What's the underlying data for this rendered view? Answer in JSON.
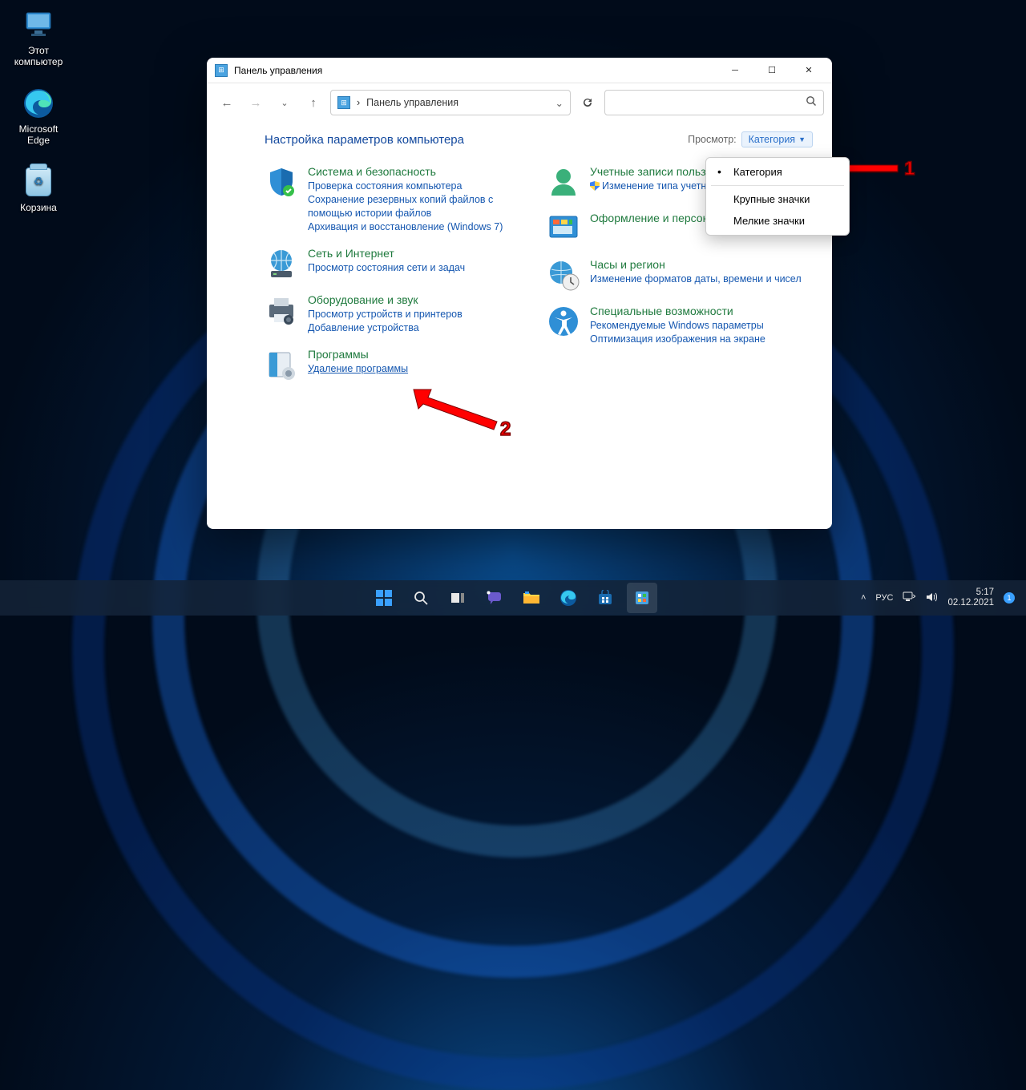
{
  "desktop": {
    "icons": [
      {
        "label": "Этот\nкомпьютер"
      },
      {
        "label": "Microsoft\nEdge"
      },
      {
        "label": "Корзина"
      }
    ]
  },
  "window": {
    "title": "Панель управления",
    "breadcrumb_sep": "›",
    "breadcrumb_text": "Панель управления",
    "heading": "Настройка параметров компьютера",
    "view_label": "Просмотр:",
    "view_value": "Категория",
    "dropdown": {
      "items": [
        "Категория",
        "Крупные значки",
        "Мелкие значки"
      ],
      "selected": "Категория"
    },
    "left_col": [
      {
        "title": "Система и безопасность",
        "links": [
          "Проверка состояния компьютера",
          "Сохранение резервных копий файлов с помощью истории файлов",
          "Архивация и восстановление (Windows 7)"
        ]
      },
      {
        "title": "Сеть и Интернет",
        "links": [
          "Просмотр состояния сети и задач"
        ]
      },
      {
        "title": "Оборудование и звук",
        "links": [
          "Просмотр устройств и принтеров",
          "Добавление устройства"
        ]
      },
      {
        "title": "Программы",
        "links": [
          "Удаление программы"
        ]
      }
    ],
    "right_col": [
      {
        "title": "Учетные записи польз",
        "links": [
          "Изменение типа учетной за"
        ],
        "shield": true
      },
      {
        "title": "Оформление и персонализация",
        "links": []
      },
      {
        "title": "Часы и регион",
        "links": [
          "Изменение форматов даты, времени и чисел"
        ]
      },
      {
        "title": "Специальные возможности",
        "links": [
          "Рекомендуемые Windows параметры",
          "Оптимизация изображения на экране"
        ]
      }
    ]
  },
  "annotations": {
    "n1": "1",
    "n2": "2"
  },
  "taskbar": {
    "lang": "РУС",
    "time": "5:17",
    "date": "02.12.2021"
  }
}
